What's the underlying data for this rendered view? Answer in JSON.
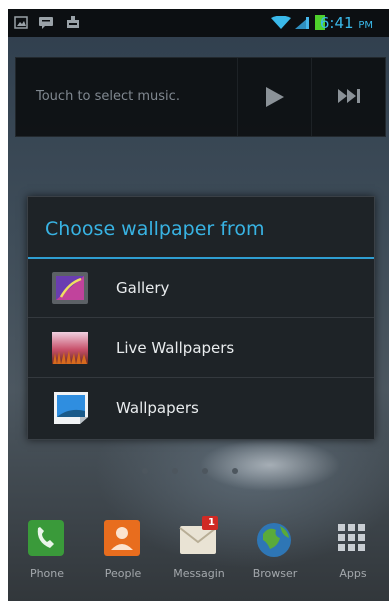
{
  "status_bar": {
    "time": "6:41",
    "ampm": "PM"
  },
  "music_widget": {
    "prompt": "Touch to select music."
  },
  "dialog": {
    "title": "Choose wallpaper from",
    "items": [
      {
        "label": "Gallery",
        "icon": "gallery-icon"
      },
      {
        "label": "Live Wallpapers",
        "icon": "live-wallpapers-icon"
      },
      {
        "label": "Wallpapers",
        "icon": "wallpapers-icon"
      }
    ]
  },
  "dock": [
    {
      "label": "Phone",
      "icon": "phone-icon"
    },
    {
      "label": "People",
      "icon": "people-icon"
    },
    {
      "label": "Messagin",
      "icon": "messaging-icon",
      "badge": "1"
    },
    {
      "label": "Browser",
      "icon": "browser-icon"
    },
    {
      "label": "Apps",
      "icon": "apps-icon"
    }
  ],
  "colors": {
    "accent": "#38b3e3",
    "time": "#3ab9ea",
    "dialog_bg": "#1e2327"
  }
}
